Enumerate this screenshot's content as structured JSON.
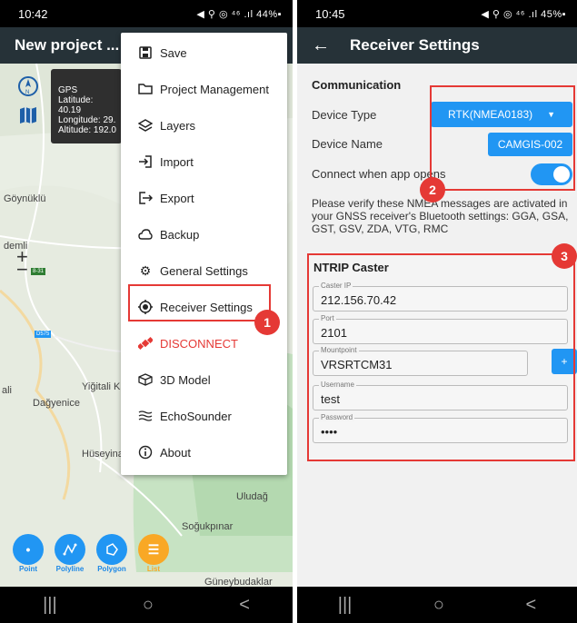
{
  "left": {
    "status": {
      "time": "10:42",
      "icons": "◀ ⚲ ◎ ⁴⁶ .ıl 44%▪"
    },
    "appbar": {
      "title": "New project ..."
    },
    "gps": {
      "title": "GPS",
      "latitude": "Latitude: 40.19",
      "longitude": "Longitude: 29.",
      "altitude": "Altitude: 192.0"
    },
    "map_labels": [
      "Göynüklü",
      "demli",
      "Yiğitali K",
      "Dağyenice",
      "ali",
      "Hüseyina",
      "Uludağ",
      "Soğukpınar",
      "Güneybudaklar"
    ],
    "road_labels": [
      "D575",
      "8-31"
    ],
    "zoom": {
      "plus": "+",
      "minus": "−"
    },
    "tools": [
      {
        "label": "Point",
        "icon": "point-icon"
      },
      {
        "label": "Polyline",
        "icon": "polyline-icon"
      },
      {
        "label": "Polygon",
        "icon": "polygon-icon"
      },
      {
        "label": "List",
        "icon": "list-icon"
      }
    ],
    "menu": [
      {
        "label": "Save",
        "icon": "save-icon"
      },
      {
        "label": "Project Management",
        "icon": "folder-icon"
      },
      {
        "label": "Layers",
        "icon": "layers-icon"
      },
      {
        "label": "Import",
        "icon": "import-icon"
      },
      {
        "label": "Export",
        "icon": "export-icon"
      },
      {
        "label": "Backup",
        "icon": "cloud-icon"
      },
      {
        "label": "General Settings",
        "icon": "gear-icon"
      },
      {
        "label": "Receiver Settings",
        "icon": "target-icon"
      },
      {
        "label": "DISCONNECT",
        "icon": "satellite-icon"
      },
      {
        "label": "3D Model",
        "icon": "cube-icon"
      },
      {
        "label": "EchoSounder",
        "icon": "wave-icon"
      },
      {
        "label": "About",
        "icon": "info-icon"
      }
    ],
    "badge": "1",
    "nav": [
      "|||",
      "○",
      "<"
    ]
  },
  "right": {
    "status": {
      "time": "10:45",
      "icons": "◀ ⚲ ◎ ⁴⁶ .ıl 45%▪"
    },
    "appbar": {
      "back": "←",
      "title": "Receiver Settings"
    },
    "communication": {
      "title": "Communication",
      "device_type_label": "Device Type",
      "device_type_value": "RTK(NMEA0183)",
      "device_name_label": "Device Name",
      "device_name_value": "CAMGIS-002",
      "connect_label": "Connect when app opens",
      "connect_on": true,
      "note": "Please verify these NMEA messages are activated in your GNSS receiver's Bluetooth settings: GGA, GSA, GST, GSV, ZDA, VTG, RMC"
    },
    "ntrip": {
      "title": "NTRIP Caster",
      "caster_ip_label": "Caster IP",
      "caster_ip": "212.156.70.42",
      "port_label": "Port",
      "port": "2101",
      "mountpoint_label": "Mountpoint",
      "mountpoint": "VRSRTCM31",
      "plus": "+",
      "username_label": "Username",
      "username": "test",
      "password_label": "Password",
      "password": "••••"
    },
    "badges": [
      "2",
      "3"
    ],
    "nav": [
      "|||",
      "○",
      "<"
    ]
  },
  "colors": {
    "accent": "#2196f3",
    "highlight": "#e53935",
    "appbar": "#263238"
  }
}
